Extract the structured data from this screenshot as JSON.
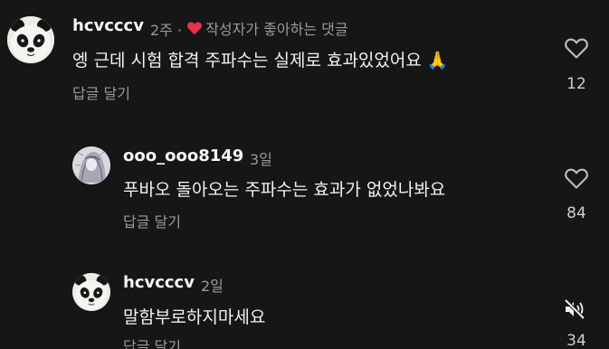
{
  "comments": [
    {
      "username": "hcvcccv",
      "time": "2주",
      "separator": "·",
      "author_liked_label": "작성자가 좋아하는 댓글",
      "text": "엥 근데 시험 합격 주파수는 실제로 효과있었어요",
      "emoji": "🙏",
      "reply_label": "답글 달기",
      "likes": "12",
      "avatar_icon": "panda-avatar"
    },
    {
      "username": "ooo_ooo8149",
      "time": "3일",
      "text": "푸바오 돌아오는 주파수는 효과가 없었나봐요",
      "reply_label": "답글 달기",
      "likes": "84",
      "avatar_icon": "sketch-avatar"
    },
    {
      "username": "hcvcccv",
      "time": "2일",
      "text": "말함부로하지마세요",
      "reply_label": "답글 달기",
      "likes": "34",
      "avatar_icon": "panda-avatar"
    }
  ],
  "icons": {
    "heart_outline": "heart-icon",
    "heart_filled": "heart-filled-icon",
    "mute": "mute-icon"
  },
  "colors": {
    "background": "#161616",
    "text_primary": "#f2f2f2",
    "text_secondary": "#9a9a9a",
    "heart_red": "#e8334a"
  }
}
